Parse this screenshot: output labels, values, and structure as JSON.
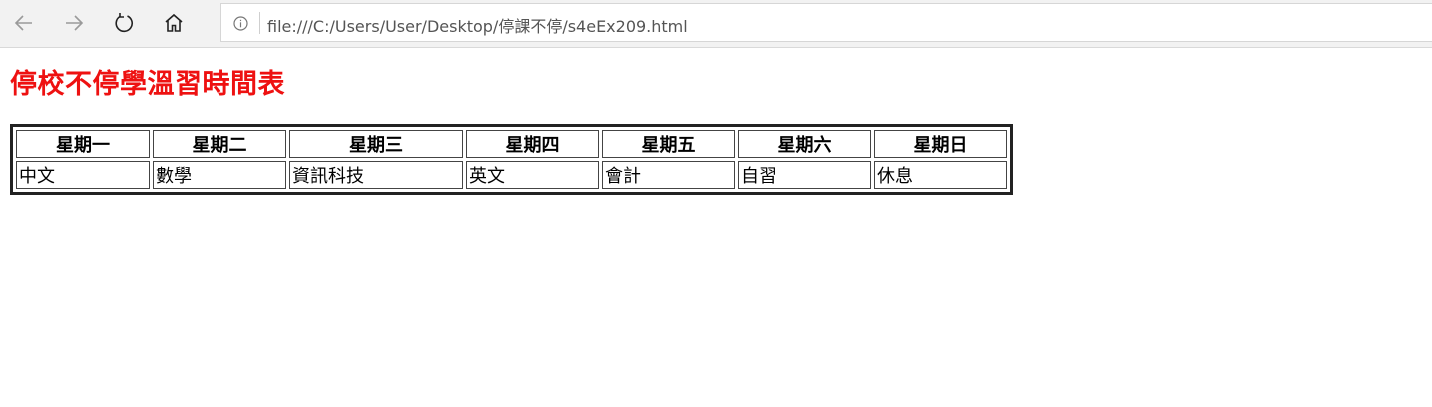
{
  "browser": {
    "url": "file:///C:/Users/User/Desktop/停課不停/s4eEx209.html",
    "icons": [
      "back-arrow-icon",
      "forward-arrow-icon",
      "reload-icon",
      "home-icon",
      "info-icon"
    ]
  },
  "page": {
    "title": "停校不停學溫習時間表",
    "title_color": "#ee1111",
    "table": {
      "headers": [
        "星期一",
        "星期二",
        "星期三",
        "星期四",
        "星期五",
        "星期六",
        "星期日"
      ],
      "rows": [
        [
          "中文",
          "數學",
          "資訊科技",
          "英文",
          "會計",
          "自習",
          "休息"
        ]
      ]
    }
  }
}
